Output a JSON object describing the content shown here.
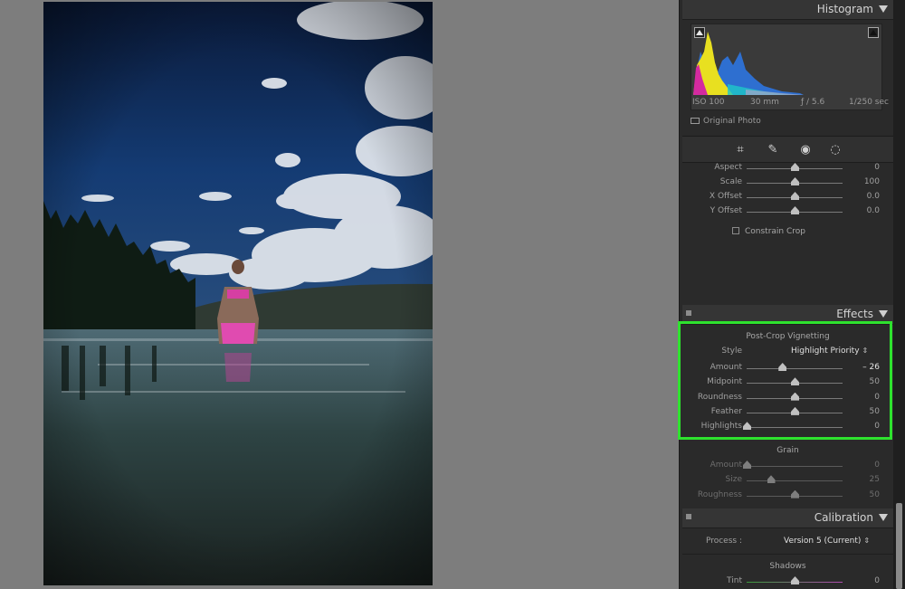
{
  "histogram": {
    "title": "Histogram",
    "iso": "ISO 100",
    "focal": "30 mm",
    "aperture": "ƒ / 5.6",
    "shutter": "1/250 sec",
    "original_photo": "Original Photo"
  },
  "tools": [
    "crop-overlay-icon",
    "spot-removal-icon",
    "red-eye-icon",
    "radial-filter-icon"
  ],
  "transform": {
    "rows": [
      {
        "label": "Aspect",
        "value": "0",
        "pos": 0.5
      },
      {
        "label": "Scale",
        "value": "100",
        "pos": 0.5
      },
      {
        "label": "X Offset",
        "value": "0.0",
        "pos": 0.5
      },
      {
        "label": "Y Offset",
        "value": "0.0",
        "pos": 0.5
      }
    ],
    "constrain_crop": "Constrain Crop"
  },
  "effects": {
    "title": "Effects",
    "vignetting_title": "Post-Crop Vignetting",
    "style_label": "Style",
    "style_value": "Highlight Priority",
    "rows": [
      {
        "label": "Amount",
        "value": "– 26",
        "pos": 0.37
      },
      {
        "label": "Midpoint",
        "value": "50",
        "pos": 0.5
      },
      {
        "label": "Roundness",
        "value": "0",
        "pos": 0.5
      },
      {
        "label": "Feather",
        "value": "50",
        "pos": 0.5
      },
      {
        "label": "Highlights",
        "value": "0",
        "pos": 0.0
      }
    ],
    "grain_title": "Grain",
    "grain_rows": [
      {
        "label": "Amount",
        "value": "0",
        "pos": 0.0
      },
      {
        "label": "Size",
        "value": "25",
        "pos": 0.25
      },
      {
        "label": "Roughness",
        "value": "50",
        "pos": 0.5
      }
    ]
  },
  "calibration": {
    "title": "Calibration",
    "process_label": "Process :",
    "process_value": "Version 5 (Current)",
    "shadows_title": "Shadows",
    "tint_label": "Tint",
    "tint_value": "0",
    "tint_pos": 0.5
  },
  "colors": {
    "highlight_box": "#2ee22e",
    "panel_bg": "#2a2a2a",
    "canvas_bg": "#7d7d7d"
  }
}
